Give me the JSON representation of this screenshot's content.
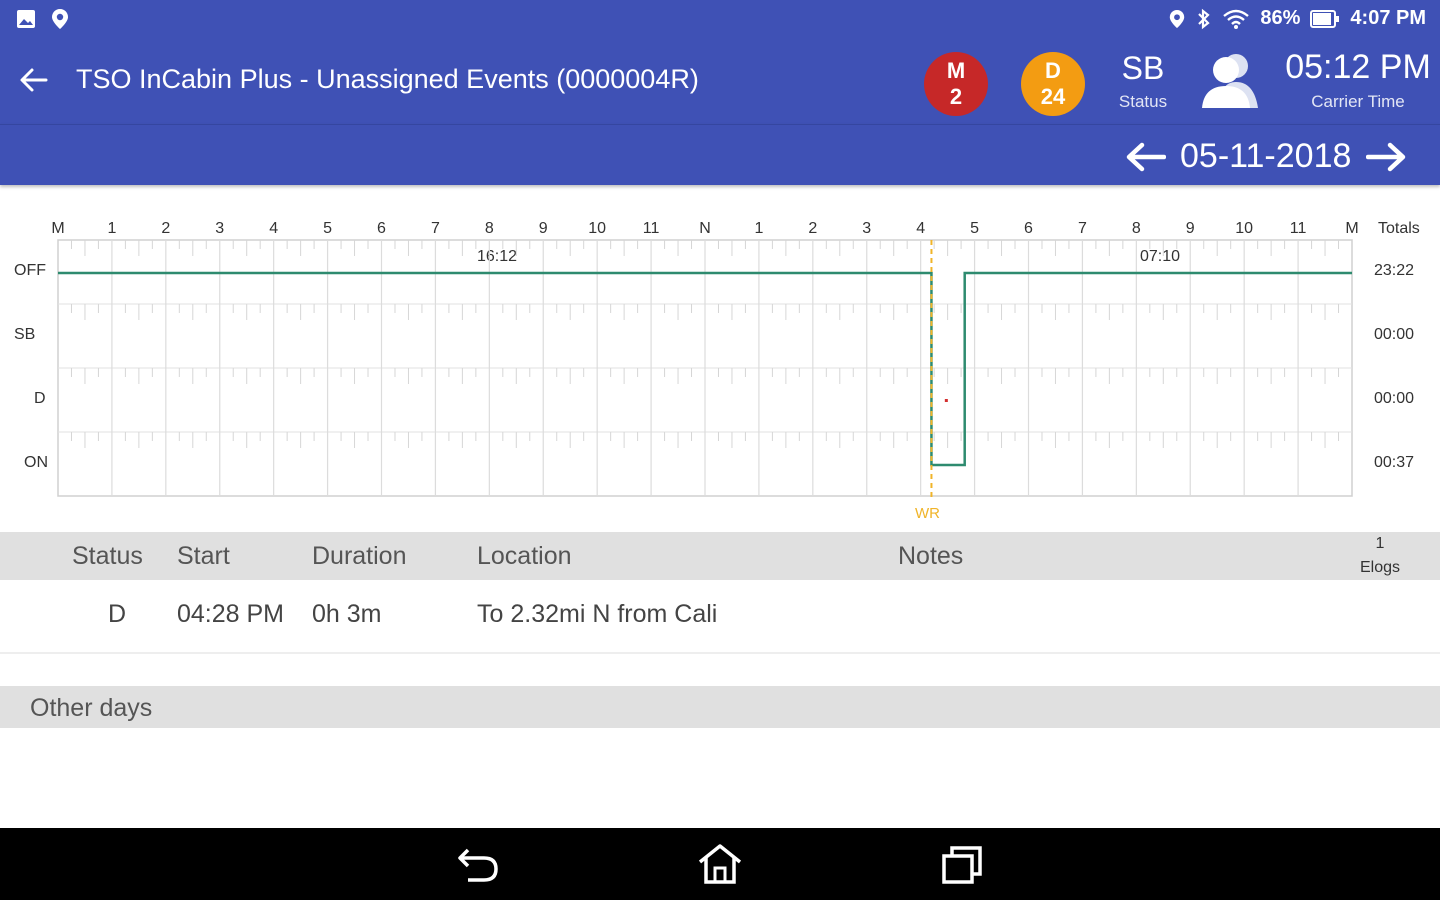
{
  "status_bar": {
    "battery": "86%",
    "time": "4:07 PM"
  },
  "app_bar": {
    "title": "TSO InCabin Plus - Unassigned Events (0000004R)",
    "badge_m": {
      "letter": "M",
      "count": "2",
      "color": "#c62828"
    },
    "badge_d": {
      "letter": "D",
      "count": "24",
      "color": "#f39c12"
    },
    "status_code": "SB",
    "status_caption": "Status",
    "clock": "05:12 PM",
    "clock_caption": "Carrier Time"
  },
  "date_bar": {
    "date": "05-11-2018"
  },
  "chart": {
    "hour_labels": [
      "M",
      "1",
      "2",
      "3",
      "4",
      "5",
      "6",
      "7",
      "8",
      "9",
      "10",
      "11",
      "N",
      "1",
      "2",
      "3",
      "4",
      "5",
      "6",
      "7",
      "8",
      "9",
      "10",
      "11",
      "M"
    ],
    "rows": [
      "OFF",
      "SB",
      "D",
      "ON"
    ],
    "totals_header": "Totals",
    "totals": [
      "23:22",
      "00:00",
      "00:00",
      "00:37"
    ],
    "segment_labels": [
      "16:12",
      "07:10"
    ],
    "marker_label": "WR",
    "line_color": "#2e8b6f",
    "marker_color": "#f0b429"
  },
  "table": {
    "headers": {
      "status": "Status",
      "start": "Start",
      "duration": "Duration",
      "location": "Location",
      "notes": "Notes",
      "elogs_count": "1",
      "elogs": "Elogs"
    },
    "rows": [
      {
        "status": "D",
        "start": "04:28 PM",
        "duration": "0h 3m",
        "location": "To 2.32mi N from Cali",
        "notes": ""
      }
    ]
  },
  "other_days": {
    "label": "Other days"
  },
  "colors": {
    "primary": "#3f51b5",
    "header_gray": "#e0e0e0"
  }
}
